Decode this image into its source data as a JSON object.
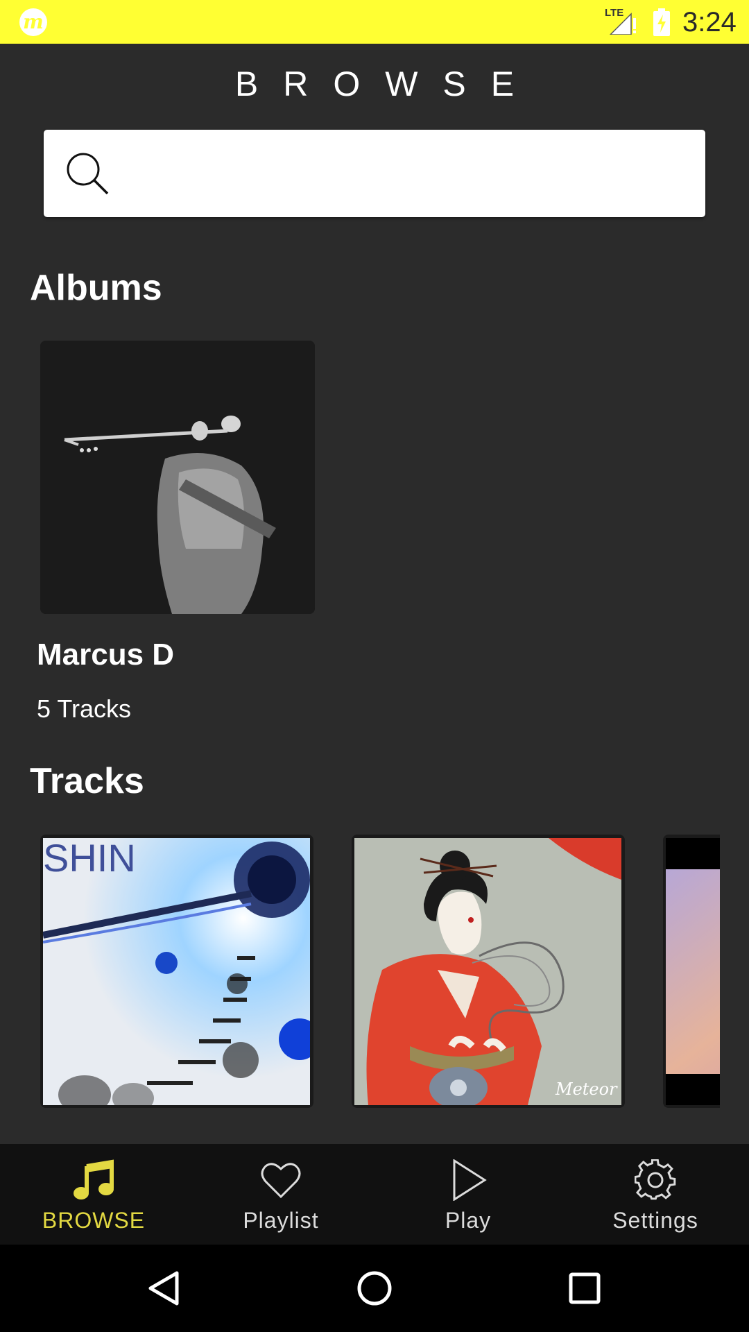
{
  "status_bar": {
    "time": "3:24",
    "network": "LTE",
    "app_icon": "m-logo-icon",
    "background": "#ffff33"
  },
  "header": {
    "title": "BROWSE"
  },
  "search": {
    "placeholder": "",
    "value": ""
  },
  "albums": {
    "heading": "Albums",
    "items": [
      {
        "name": "Marcus D",
        "subtitle": "5 Tracks"
      }
    ]
  },
  "tracks": {
    "heading": "Tracks"
  },
  "bottom_nav": {
    "active_color": "#e3d942",
    "items": [
      {
        "label": "BROWSE",
        "icon": "music-note-icon",
        "active": true
      },
      {
        "label": "Playlist",
        "icon": "heart-icon",
        "active": false
      },
      {
        "label": "Play",
        "icon": "play-icon",
        "active": false
      },
      {
        "label": "Settings",
        "icon": "gear-icon",
        "active": false
      }
    ]
  },
  "system_nav": {
    "icons": [
      "back-icon",
      "home-icon",
      "recents-icon"
    ]
  }
}
